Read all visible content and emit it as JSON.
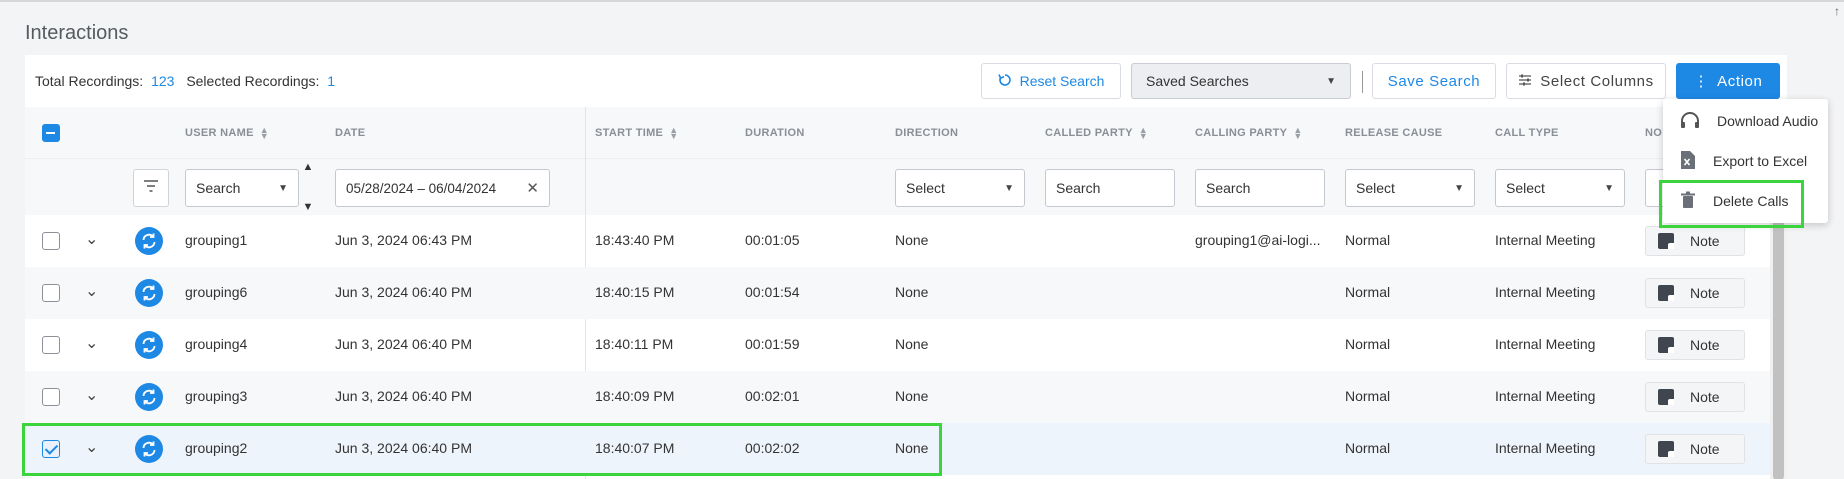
{
  "page": {
    "title": "Interactions"
  },
  "toolbar": {
    "total_label": "Total Recordings:",
    "total_value": "123",
    "selected_label": "Selected Recordings:",
    "selected_value": "1",
    "reset_label": "Reset Search",
    "saved_searches_label": "Saved Searches",
    "save_search_label": "Save Search",
    "select_columns_label": "Select Columns",
    "action_label": "Action"
  },
  "columns": {
    "user_name": "USER NAME",
    "date": "DATE",
    "start_time": "START TIME",
    "duration": "DURATION",
    "direction": "DIRECTION",
    "called_party": "CALLED PARTY",
    "calling_party": "CALLING PARTY",
    "release_cause": "RELEASE CAUSE",
    "call_type": "CALL TYPE",
    "notes": "NO"
  },
  "filters": {
    "user_name": "Search",
    "date_range": "05/28/2024 – 06/04/2024",
    "direction": "Select",
    "called_party": "Search",
    "calling_party": "Search",
    "release_cause": "Select",
    "call_type": "Select"
  },
  "rows": [
    {
      "user": "grouping1",
      "date": "Jun 3, 2024 06:43 PM",
      "start": "18:43:40 PM",
      "duration": "00:01:05",
      "direction": "None",
      "called": "",
      "calling": "grouping1@ai-logi...",
      "release": "Normal",
      "call_type": "Internal Meeting",
      "note": "Note",
      "checked": false
    },
    {
      "user": "grouping6",
      "date": "Jun 3, 2024 06:40 PM",
      "start": "18:40:15 PM",
      "duration": "00:01:54",
      "direction": "None",
      "called": "",
      "calling": "",
      "release": "Normal",
      "call_type": "Internal Meeting",
      "note": "Note",
      "checked": false
    },
    {
      "user": "grouping4",
      "date": "Jun 3, 2024 06:40 PM",
      "start": "18:40:11 PM",
      "duration": "00:01:59",
      "direction": "None",
      "called": "",
      "calling": "",
      "release": "Normal",
      "call_type": "Internal Meeting",
      "note": "Note",
      "checked": false
    },
    {
      "user": "grouping3",
      "date": "Jun 3, 2024 06:40 PM",
      "start": "18:40:09 PM",
      "duration": "00:02:01",
      "direction": "None",
      "called": "",
      "calling": "",
      "release": "Normal",
      "call_type": "Internal Meeting",
      "note": "Note",
      "checked": false
    },
    {
      "user": "grouping2",
      "date": "Jun 3, 2024 06:40 PM",
      "start": "18:40:07 PM",
      "duration": "00:02:02",
      "direction": "None",
      "called": "",
      "calling": "",
      "release": "Normal",
      "call_type": "Internal Meeting",
      "note": "Note",
      "checked": true
    }
  ],
  "action_menu": {
    "items": [
      {
        "label": "Download Audio",
        "icon": "headphones-icon"
      },
      {
        "label": "Export to Excel",
        "icon": "excel-file-icon"
      },
      {
        "label": "Delete Calls",
        "icon": "trash-icon"
      }
    ]
  },
  "colors": {
    "accent": "#1e88e5",
    "highlight": "#3cd43c"
  }
}
